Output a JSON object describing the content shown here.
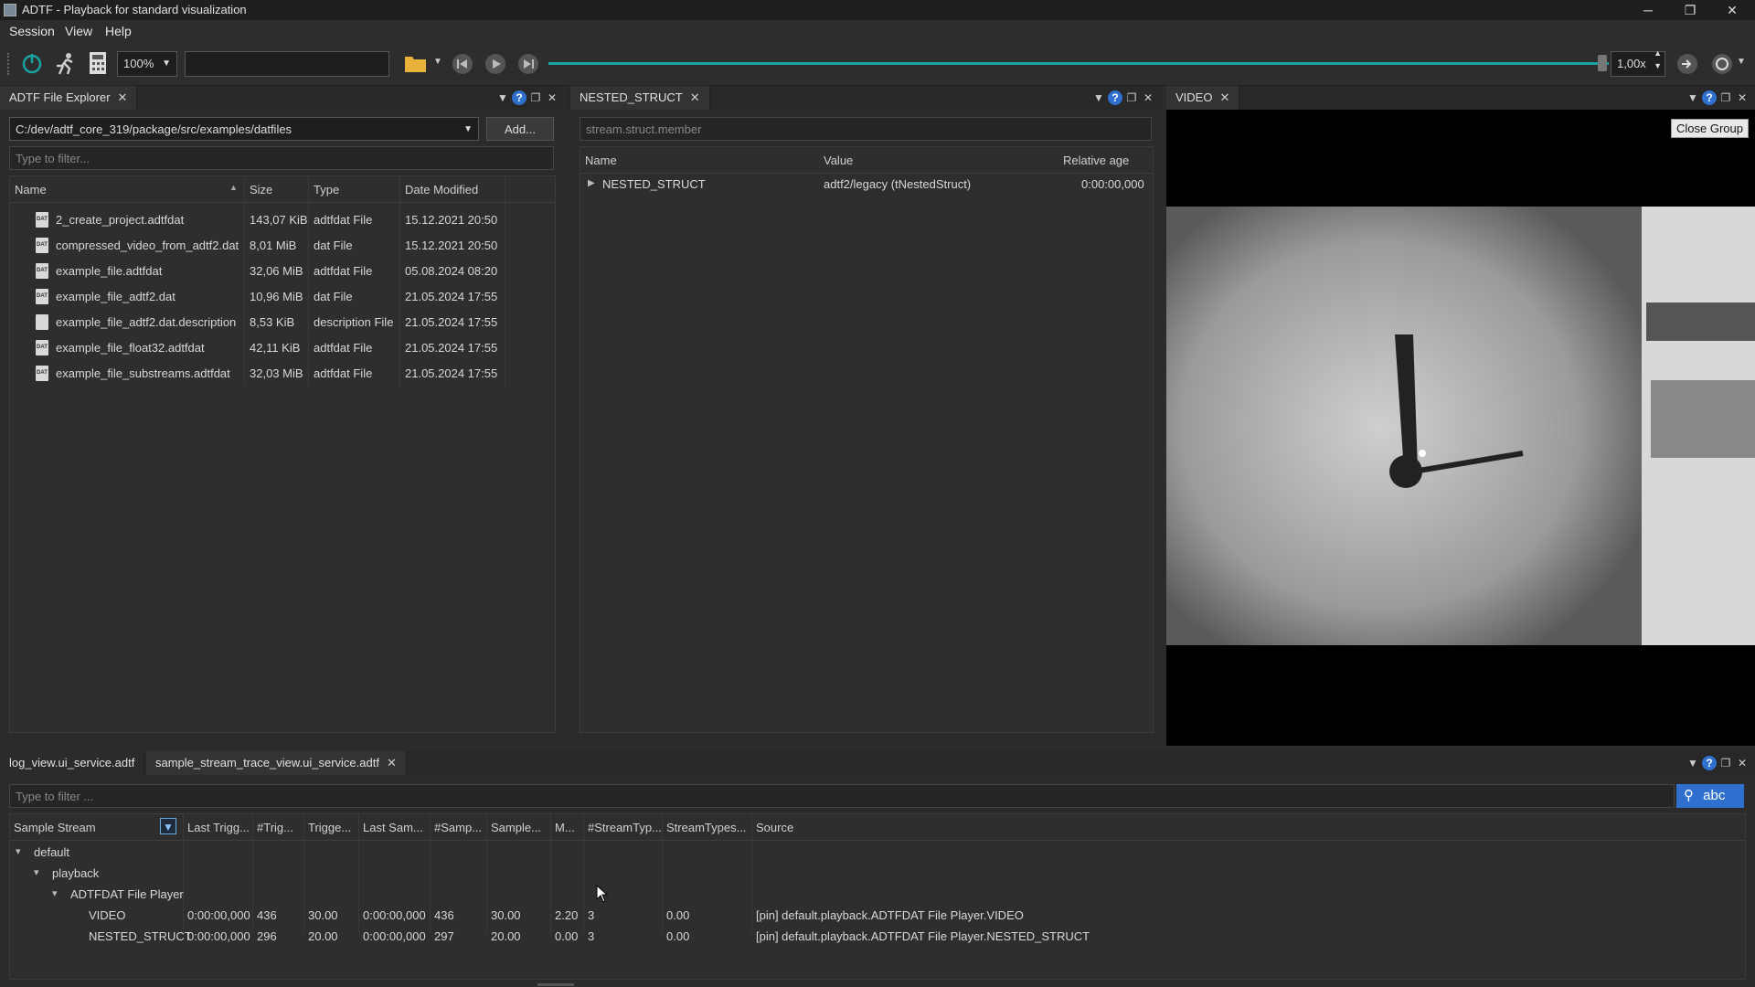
{
  "window": {
    "title": "ADTF - Playback for standard visualization",
    "minimize": "─",
    "restore": "❐",
    "close": "✕"
  },
  "menu": [
    "Session",
    "View",
    "Help"
  ],
  "toolbar": {
    "zoom": "100%",
    "speed": "1,00x",
    "icons": [
      "power-icon",
      "runner-icon",
      "calculator-icon",
      "folder-icon",
      "skip-back-icon",
      "play-icon",
      "skip-forward-icon",
      "link-icon",
      "loop-icon"
    ],
    "accent": "#1aa3a3"
  },
  "file_explorer": {
    "tab": "ADTF File Explorer",
    "path": "C:/dev/adtf_core_319/package/src/examples/datfiles",
    "add_button": "Add...",
    "filter_placeholder": "Type to filter...",
    "columns": [
      "Name",
      "Size",
      "Type",
      "Date Modified"
    ],
    "rows": [
      {
        "name": "2_create_project.adtfdat",
        "size": "143,07 KiB",
        "type": "adtfdat File",
        "date": "15.12.2021 20:50",
        "icon": "DAT"
      },
      {
        "name": "compressed_video_from_adtf2.dat",
        "size": "8,01 MiB",
        "type": "dat File",
        "date": "15.12.2021 20:50",
        "icon": "DAT"
      },
      {
        "name": "example_file.adtfdat",
        "size": "32,06 MiB",
        "type": "adtfdat File",
        "date": "05.08.2024 08:20",
        "icon": "DAT"
      },
      {
        "name": "example_file_adtf2.dat",
        "size": "10,96 MiB",
        "type": "dat File",
        "date": "21.05.2024 17:55",
        "icon": "DAT"
      },
      {
        "name": "example_file_adtf2.dat.description",
        "size": "8,53 KiB",
        "type": "description File",
        "date": "21.05.2024 17:55",
        "icon": ""
      },
      {
        "name": "example_file_float32.adtfdat",
        "size": "42,11 KiB",
        "type": "adtfdat File",
        "date": "21.05.2024 17:55",
        "icon": "DAT"
      },
      {
        "name": "example_file_substreams.adtfdat",
        "size": "32,03 MiB",
        "type": "adtfdat File",
        "date": "21.05.2024 17:55",
        "icon": "DAT"
      }
    ]
  },
  "nested_struct": {
    "tab": "NESTED_STRUCT",
    "filter_placeholder": "stream.struct.member",
    "columns": [
      "Name",
      "Value",
      "Relative age"
    ],
    "rows": [
      {
        "name": "NESTED_STRUCT",
        "value": "adtf2/legacy (tNestedStruct)",
        "age": "0:00:00,000"
      }
    ]
  },
  "video": {
    "tab": "VIDEO",
    "tooltip": "Close Group"
  },
  "bottom": {
    "tabs": [
      "log_view.ui_service.adtf",
      "sample_stream_trace_view.ui_service.adtf"
    ],
    "filter_placeholder": "Type to filter ...",
    "search_label": "abc",
    "columns": [
      "Sample Stream",
      "Last Trigg...",
      "#Trig...",
      "Trigge...",
      "Last Sam...",
      "#Samp...",
      "Sample...",
      "M...",
      "#StreamTyp...",
      "StreamTypes...",
      "Source"
    ],
    "tree": [
      {
        "label": "default",
        "level": 0,
        "expander": "▾"
      },
      {
        "label": "playback",
        "level": 1,
        "expander": "▾"
      },
      {
        "label": "ADTFDAT File Player",
        "level": 2,
        "expander": "▾"
      }
    ],
    "rows": [
      {
        "name": "VIDEO",
        "cells": [
          "0:00:00,000",
          "436",
          "30.00",
          "0:00:00,000",
          "436",
          "30.00",
          "2.20",
          "3",
          "0.00",
          "[pin] default.playback.ADTFDAT File Player.VIDEO"
        ]
      },
      {
        "name": "NESTED_STRUCT",
        "cells": [
          "0:00:00,000",
          "296",
          "20.00",
          "0:00:00,000",
          "297",
          "20.00",
          "0.00",
          "3",
          "0.00",
          "[pin] default.playback.ADTFDAT File Player.NESTED_STRUCT"
        ]
      }
    ]
  }
}
